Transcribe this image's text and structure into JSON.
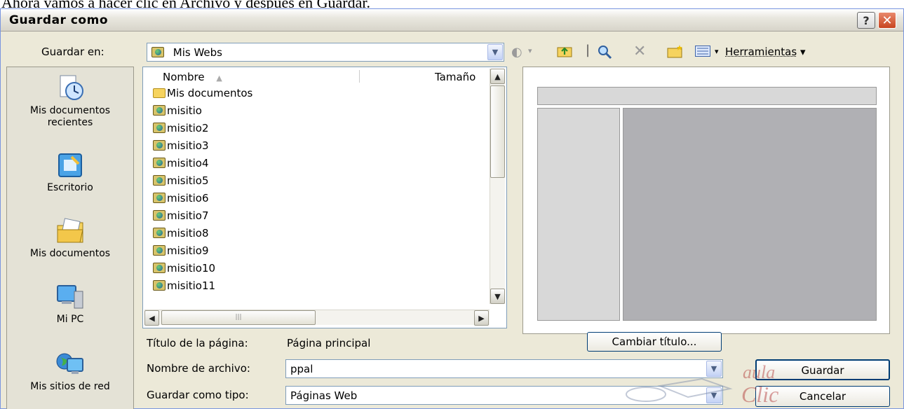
{
  "caption": "Ahora vamos a hacer clic en Archivo y después en Guardar.",
  "window": {
    "title": "Guardar como",
    "help_glyph": "?",
    "close_glyph": "✕"
  },
  "save_in": {
    "label": "Guardar en:",
    "value": "Mis Webs",
    "tools_label": "Herramientas"
  },
  "places": [
    {
      "label": "Mis documentos recientes",
      "icon": "recent-documents-icon"
    },
    {
      "label": "Escritorio",
      "icon": "desktop-icon"
    },
    {
      "label": "Mis documentos",
      "icon": "my-documents-icon"
    },
    {
      "label": "Mi PC",
      "icon": "my-computer-icon"
    },
    {
      "label": "Mis sitios de red",
      "icon": "network-places-icon"
    }
  ],
  "filelist": {
    "columns": [
      "Nombre",
      "Tamaño"
    ],
    "items": [
      {
        "name": "Mis documentos",
        "icon": "folder-icon"
      },
      {
        "name": "misitio",
        "icon": "web-folder-icon"
      },
      {
        "name": "misitio2",
        "icon": "web-folder-icon"
      },
      {
        "name": "misitio3",
        "icon": "web-folder-icon"
      },
      {
        "name": "misitio4",
        "icon": "web-folder-icon"
      },
      {
        "name": "misitio5",
        "icon": "web-folder-icon"
      },
      {
        "name": "misitio6",
        "icon": "web-folder-icon"
      },
      {
        "name": "misitio7",
        "icon": "web-folder-icon"
      },
      {
        "name": "misitio8",
        "icon": "web-folder-icon"
      },
      {
        "name": "misitio9",
        "icon": "web-folder-icon"
      },
      {
        "name": "misitio10",
        "icon": "web-folder-icon"
      },
      {
        "name": "misitio11",
        "icon": "web-folder-icon"
      }
    ]
  },
  "page_title": {
    "label": "Título de la página:",
    "value": "Página principal",
    "change_button": "Cambiar título..."
  },
  "filename": {
    "label": "Nombre de archivo:",
    "value": "ppal"
  },
  "filetype": {
    "label": "Guardar como tipo:",
    "value": "Páginas Web"
  },
  "buttons": {
    "save": "Guardar",
    "cancel": "Cancelar"
  },
  "watermark": {
    "text1": "aula",
    "text2": "Clic"
  },
  "colors": {
    "dialog_bg": "#ece9d8",
    "close_red": "#c8441f",
    "button_border": "#003c74"
  }
}
